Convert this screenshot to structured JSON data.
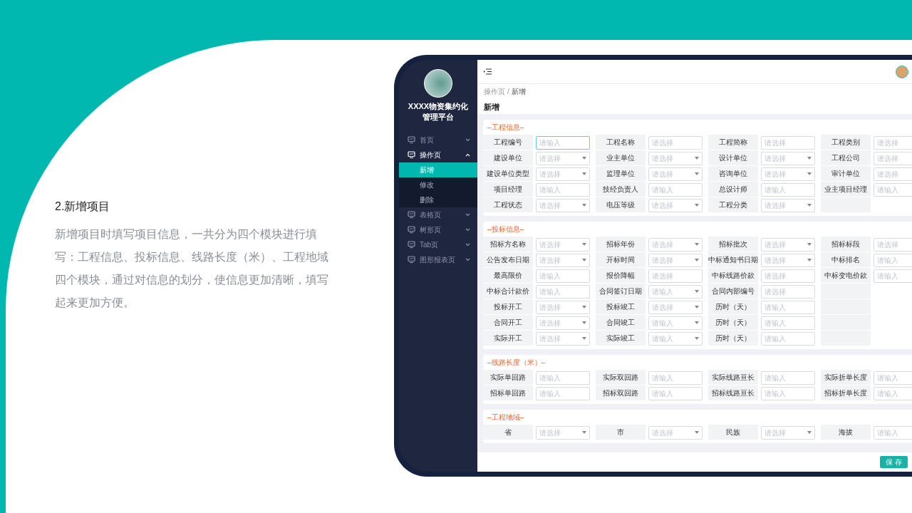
{
  "slide": {
    "heading": "2.新增项目",
    "description": "新增项目时填写项目信息，一共分为四个模块进行填写：工程信息、投标信息、线路长度（米）、工程地域四个模块，通过对信息的划分，使信息更加清晰，填写起来更加方便。"
  },
  "sidebar": {
    "title": "XXXX物资集约化管理平台",
    "items": [
      {
        "label": "首页",
        "expanded": false
      },
      {
        "label": "操作页",
        "expanded": true,
        "children": [
          {
            "label": "新增",
            "selected": true
          },
          {
            "label": "修改",
            "selected": false
          },
          {
            "label": "删除",
            "selected": false
          }
        ]
      },
      {
        "label": "表格页",
        "expanded": false
      },
      {
        "label": "树形页",
        "expanded": false
      },
      {
        "label": "Tab页",
        "expanded": false
      },
      {
        "label": "图形报表页",
        "expanded": false
      }
    ]
  },
  "breadcrumb": {
    "items": [
      "操作页",
      "新增"
    ],
    "separator": "/"
  },
  "page_title": "新增",
  "sections": [
    {
      "title": "–工程信息–",
      "rows": [
        [
          {
            "label": "工程编号",
            "placeholder": "请输入",
            "kind": "input",
            "focused": true
          },
          {
            "label": "工程名称",
            "placeholder": "请选择",
            "kind": "input",
            "focused": false
          },
          {
            "label": "工程简称",
            "placeholder": "请选择",
            "kind": "input",
            "focused": false
          },
          {
            "label": "工程类别",
            "placeholder": "请选择",
            "kind": "input",
            "focused": false
          }
        ],
        [
          {
            "label": "建设单位",
            "placeholder": "请选择",
            "kind": "select",
            "focused": false
          },
          {
            "label": "业主单位",
            "placeholder": "请选择",
            "kind": "select",
            "focused": false
          },
          {
            "label": "设计单位",
            "placeholder": "请选择",
            "kind": "select",
            "focused": false
          },
          {
            "label": "工程公司",
            "placeholder": "请选择",
            "kind": "input",
            "focused": false
          }
        ],
        [
          {
            "label": "建设单位类型",
            "placeholder": "请选择",
            "kind": "select",
            "focused": false
          },
          {
            "label": "监理单位",
            "placeholder": "请选择",
            "kind": "select",
            "focused": false
          },
          {
            "label": "咨询单位",
            "placeholder": "请选择",
            "kind": "select",
            "focused": false
          },
          {
            "label": "审计单位",
            "placeholder": "请选择",
            "kind": "input",
            "focused": false
          }
        ],
        [
          {
            "label": "项目经理",
            "placeholder": "请输入",
            "kind": "input",
            "focused": false
          },
          {
            "label": "技经负责人",
            "placeholder": "请输入",
            "kind": "input",
            "focused": false
          },
          {
            "label": "总设计师",
            "placeholder": "请输入",
            "kind": "input",
            "focused": false
          },
          {
            "label": "业主项目经理",
            "placeholder": "请输入",
            "kind": "input",
            "focused": false
          }
        ],
        [
          {
            "label": "工程状态",
            "placeholder": "请选择",
            "kind": "select",
            "focused": false
          },
          {
            "label": "电压等级",
            "placeholder": "请选择",
            "kind": "select",
            "focused": false
          },
          {
            "label": "工程分类",
            "placeholder": "请选择",
            "kind": "select",
            "focused": false
          }
        ]
      ]
    },
    {
      "title": "–投标信息–",
      "rows": [
        [
          {
            "label": "招标方名称",
            "placeholder": "请选择",
            "kind": "select",
            "focused": false
          },
          {
            "label": "招标年份",
            "placeholder": "请选择",
            "kind": "select",
            "focused": false
          },
          {
            "label": "招标批次",
            "placeholder": "请选择",
            "kind": "select",
            "focused": false
          },
          {
            "label": "招标标段",
            "placeholder": "请选择",
            "kind": "input",
            "focused": false
          }
        ],
        [
          {
            "label": "公告发布日期",
            "placeholder": "请选择",
            "kind": "select",
            "focused": false
          },
          {
            "label": "开标时间",
            "placeholder": "请选择",
            "kind": "select",
            "focused": false
          },
          {
            "label": "中标通知书日期",
            "placeholder": "请选择",
            "kind": "select",
            "focused": false
          },
          {
            "label": "中标排名",
            "placeholder": "请输入",
            "kind": "input",
            "focused": false
          }
        ],
        [
          {
            "label": "最高限价",
            "placeholder": "请输入",
            "kind": "input",
            "focused": false
          },
          {
            "label": "报价降幅",
            "placeholder": "请选择",
            "kind": "input",
            "focused": false
          },
          {
            "label": "中标线路价款",
            "placeholder": "请选择",
            "kind": "input",
            "focused": false
          },
          {
            "label": "中标变电价款",
            "placeholder": "请输入",
            "kind": "input",
            "focused": false
          }
        ],
        [
          {
            "label": "中标合计款价",
            "placeholder": "请输入",
            "kind": "input",
            "focused": false
          },
          {
            "label": "合同签订日期",
            "placeholder": "请输入",
            "kind": "select",
            "focused": false
          },
          {
            "label": "合同内部编号",
            "placeholder": "请选择",
            "kind": "input",
            "focused": false
          }
        ],
        [
          {
            "label": "投标开工",
            "placeholder": "请选择",
            "kind": "select",
            "focused": false
          },
          {
            "label": "投标竣工",
            "placeholder": "请选择",
            "kind": "select",
            "focused": false
          },
          {
            "label": "历时（天）",
            "placeholder": "请输入",
            "kind": "input",
            "focused": false
          }
        ],
        [
          {
            "label": "合同开工",
            "placeholder": "请选择",
            "kind": "select",
            "focused": false
          },
          {
            "label": "合同竣工",
            "placeholder": "请输入",
            "kind": "select",
            "focused": false
          },
          {
            "label": "历时（天）",
            "placeholder": "请输入",
            "kind": "input",
            "focused": false
          }
        ],
        [
          {
            "label": "实际开工",
            "placeholder": "请选择",
            "kind": "select",
            "focused": false
          },
          {
            "label": "实际竣工",
            "placeholder": "请输入",
            "kind": "select",
            "focused": false
          },
          {
            "label": "历时（天）",
            "placeholder": "请输入",
            "kind": "input",
            "focused": false
          }
        ]
      ]
    },
    {
      "title": "–线路长度（米）–",
      "rows": [
        [
          {
            "label": "实际单回路",
            "placeholder": "请输入",
            "kind": "input",
            "focused": false
          },
          {
            "label": "实际双回路",
            "placeholder": "请输入",
            "kind": "input",
            "focused": false
          },
          {
            "label": "实际线路亘长",
            "placeholder": "请输入",
            "kind": "input",
            "focused": false
          },
          {
            "label": "实际折单长度",
            "placeholder": "请输入",
            "kind": "input",
            "focused": false
          }
        ],
        [
          {
            "label": "招标单回路",
            "placeholder": "请输入",
            "kind": "input",
            "focused": false
          },
          {
            "label": "招标双回路",
            "placeholder": "请输入",
            "kind": "input",
            "focused": false
          },
          {
            "label": "招标线路亘长",
            "placeholder": "请输入",
            "kind": "input",
            "focused": false
          },
          {
            "label": "招标折单长度",
            "placeholder": "请输入",
            "kind": "input",
            "focused": false
          }
        ]
      ]
    },
    {
      "title": "–工程地域–",
      "rows": [
        [
          {
            "label": "省",
            "placeholder": "请选择",
            "kind": "select",
            "focused": false
          },
          {
            "label": "市",
            "placeholder": "请选择",
            "kind": "select",
            "focused": false
          },
          {
            "label": "民族",
            "placeholder": "请选择",
            "kind": "select",
            "focused": false
          },
          {
            "label": "海拔",
            "placeholder": "请输入",
            "kind": "input",
            "focused": false
          }
        ]
      ]
    }
  ],
  "footer": {
    "buttons": [
      "保 存"
    ]
  }
}
